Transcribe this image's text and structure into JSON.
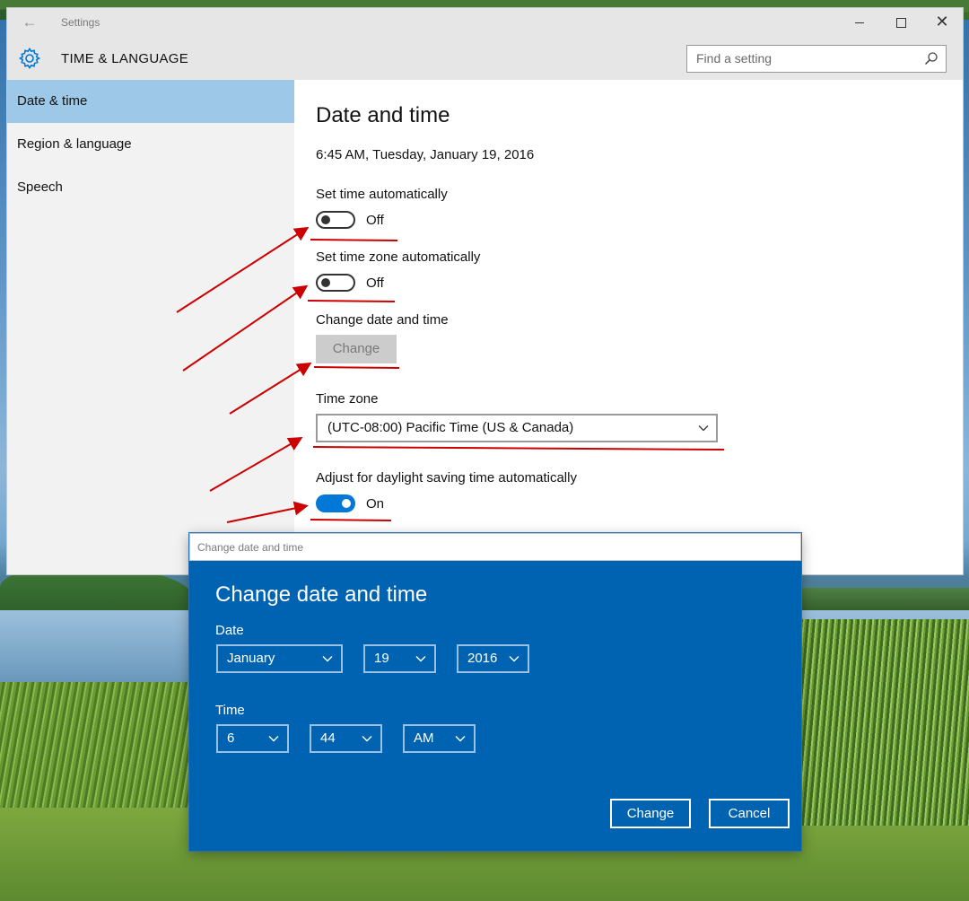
{
  "window": {
    "app_title": "Settings",
    "section_title": "TIME & LANGUAGE",
    "search": {
      "placeholder": "Find a setting",
      "value": ""
    }
  },
  "sidebar": {
    "items": [
      {
        "label": "Date & time",
        "active": true
      },
      {
        "label": "Region & language",
        "active": false
      },
      {
        "label": "Speech",
        "active": false
      }
    ]
  },
  "content": {
    "page_title": "Date and time",
    "current_datetime": "6:45 AM, Tuesday, January 19, 2016",
    "set_time_auto": {
      "label": "Set time automatically",
      "state": "Off"
    },
    "set_tz_auto": {
      "label": "Set time zone automatically",
      "state": "Off"
    },
    "change_dt": {
      "label": "Change date and time",
      "button": "Change"
    },
    "time_zone": {
      "label": "Time zone",
      "value": "(UTC-08:00) Pacific Time (US & Canada)"
    },
    "dst": {
      "label": "Adjust for daylight saving time automatically",
      "state": "On"
    }
  },
  "dialog": {
    "window_title": "Change date and time",
    "heading": "Change date and time",
    "date_label": "Date",
    "month": "January",
    "day": "19",
    "year": "2016",
    "time_label": "Time",
    "hour": "6",
    "minute": "44",
    "ampm": "AM",
    "change_button": "Change",
    "cancel_button": "Cancel"
  },
  "colors": {
    "accent": "#0078d7",
    "dialog_bg": "#0063b1",
    "nav_active": "#9ec8e8",
    "annotation": "#cc0000"
  },
  "icons": [
    "back-arrow-icon",
    "gear-icon",
    "search-icon",
    "minimize-icon",
    "maximize-icon",
    "close-icon",
    "chevron-down-icon"
  ]
}
